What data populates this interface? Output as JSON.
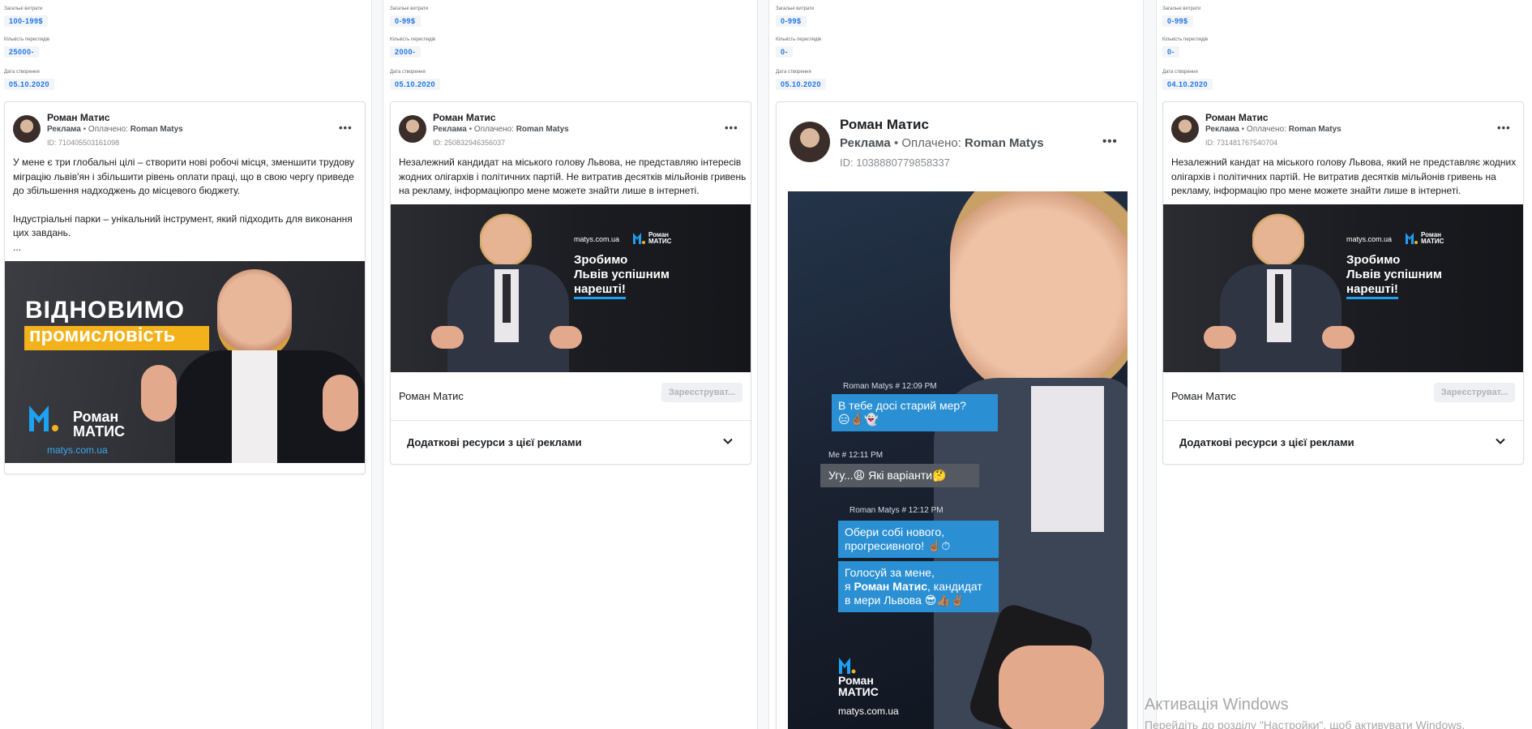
{
  "meta_labels": {
    "spend": "Загальні витрати",
    "impressions": "Кількість переглядів",
    "created": "Дата створення"
  },
  "columns": [
    {
      "spend": "100-199$",
      "impressions": "25000-",
      "created": "05.10.2020",
      "ad": {
        "page_name": "Роман Матис",
        "sponsored": "Реклама",
        "paid_prefix": " • Оплачено: ",
        "paid_by": "Roman Matys",
        "id": "ID: 710405503161098",
        "text_p1": "У мене є три глобальні цілі – створити нові робочі місця, зменшити трудову міграцію львів'ян і збільшити рівень оплати праці, що в свою чергу приведе до збільшення надходжень до місцевого бюджету.",
        "text_p2": "Індустріальні парки – унікальний інструмент, який підходить для виконання цих завдань.",
        "ellipsis": "...",
        "creative": {
          "headline_1": "ВІДНОВИМО",
          "headline_2": "промисловість",
          "brand_1": "Роман",
          "brand_2": "МАТИС",
          "site": "matys.com.ua"
        }
      }
    },
    {
      "spend": "0-99$",
      "impressions": "2000-",
      "created": "05.10.2020",
      "ad": {
        "page_name": "Роман Матис",
        "sponsored": "Реклама",
        "paid_prefix": " • Оплачено: ",
        "paid_by": "Roman Matys",
        "id": "ID: 250832946356037",
        "text": "Незалежний кандидат на міського голову Львова, не представляю інтересів жодних олігархів і політичних партій. Не витратив десятків мільйонів гривень на рекламу, інформаціюпро мене можете знайти лише в інтернеті.",
        "creative": {
          "site": "matys.com.ua",
          "brand_1": "Роман",
          "brand_2": "МАТИС",
          "slogan_1": "Зробимо",
          "slogan_2": "Львів успішним",
          "slogan_3": "нарешті!"
        },
        "cta_page": "Роман Матис",
        "cta_button": "Зареєструват...",
        "extra": "Додаткові ресурси з цієї реклами"
      }
    },
    {
      "spend": "0-99$",
      "impressions": "0-",
      "created": "05.10.2020",
      "ad": {
        "page_name": "Роман Матис",
        "sponsored": "Реклама",
        "paid_prefix": " • Оплачено: ",
        "paid_by": "Roman Matys",
        "id": "ID: 1038880779858337",
        "creative": {
          "msg1_meta": "Roman Matys # 12:09 PM",
          "msg1": "В тебе досі старий мер?",
          "msg1_emoji": "😑🤞🏽👻",
          "msg2_meta": "Me # 12:11 PM",
          "msg2": "Угу...😩 Які варіанти🤔",
          "msg3_meta": "Roman Matys # 12:12 PM",
          "msg3": "Обери собі нового, прогресивного! ☝🏽⏱",
          "msg4_a": "Голосуй за мене,",
          "msg4_b": "я ",
          "msg4_bold": "Роман Матис",
          "msg4_c": ", кандидат",
          "msg4_d": "в мери Львова 😎👍🏽✌🏽",
          "brand_1": "Роман",
          "brand_2": "МАТИС",
          "site": "matys.com.ua"
        }
      }
    },
    {
      "spend": "0-99$",
      "impressions": "0-",
      "created": "04.10.2020",
      "ad": {
        "page_name": "Роман Матис",
        "sponsored": "Реклама",
        "paid_prefix": " • Оплачено: ",
        "paid_by": "Roman Matys",
        "id": "ID: 731481767540704",
        "text": "Незалежний кандат на міського голову Львова, який не представляє жодних олігархів і політичних партій. Не витратив десятків мільйонів гривень на рекламу, інформацію про мене можете знайти лише в інтернеті.",
        "creative": {
          "site": "matys.com.ua",
          "brand_1": "Роман",
          "brand_2": "МАТИС",
          "slogan_1": "Зробимо",
          "slogan_2": "Львів успішним",
          "slogan_3": "нарешті!"
        },
        "cta_page": "Роман Матис",
        "cta_button": "Зареєструват...",
        "extra": "Додаткові ресурси з цієї реклами"
      }
    }
  ],
  "watermark": {
    "title": "Активація Windows",
    "subtitle": "Перейдіть до розділу \"Настройки\", щоб активувати Windows."
  },
  "colors": {
    "chip_text": "#1b74e4",
    "brand_blue": "#1da1f2",
    "dark_bg": "#17181c"
  },
  "icons": [
    "more-options-icon",
    "chevron-down-icon",
    "avatar"
  ]
}
